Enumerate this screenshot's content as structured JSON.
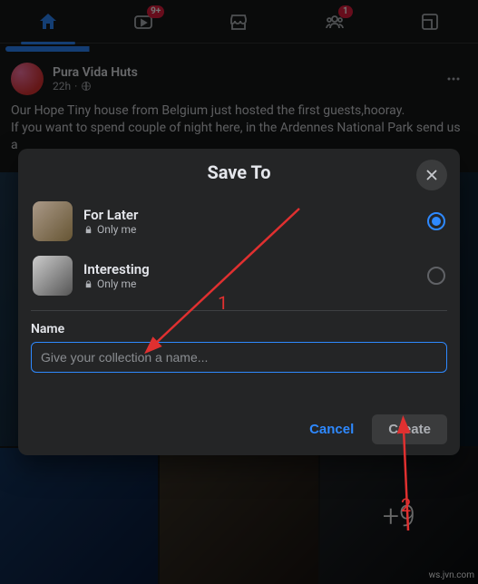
{
  "nav": {
    "watch_badge": "9+",
    "groups_badge": "1"
  },
  "post": {
    "author": "Pura Vida Huts",
    "time": "22h",
    "body_line1": "Our Hope Tiny house from Belgium just hosted the first guests,hooray.",
    "body_line2": "If you want to spend couple of night here, in the Ardennes National Park send us a"
  },
  "photos": {
    "more_count": "+9"
  },
  "modal": {
    "title": "Save To",
    "collections": [
      {
        "name": "For Later",
        "privacy": "Only me"
      },
      {
        "name": "Interesting",
        "privacy": "Only me"
      }
    ],
    "new_label": "Name",
    "new_placeholder": "Give your collection a name...",
    "cancel": "Cancel",
    "create": "Create"
  },
  "annotations": {
    "num1": "1",
    "num2": "2"
  },
  "watermark": "ws.jvn.com"
}
